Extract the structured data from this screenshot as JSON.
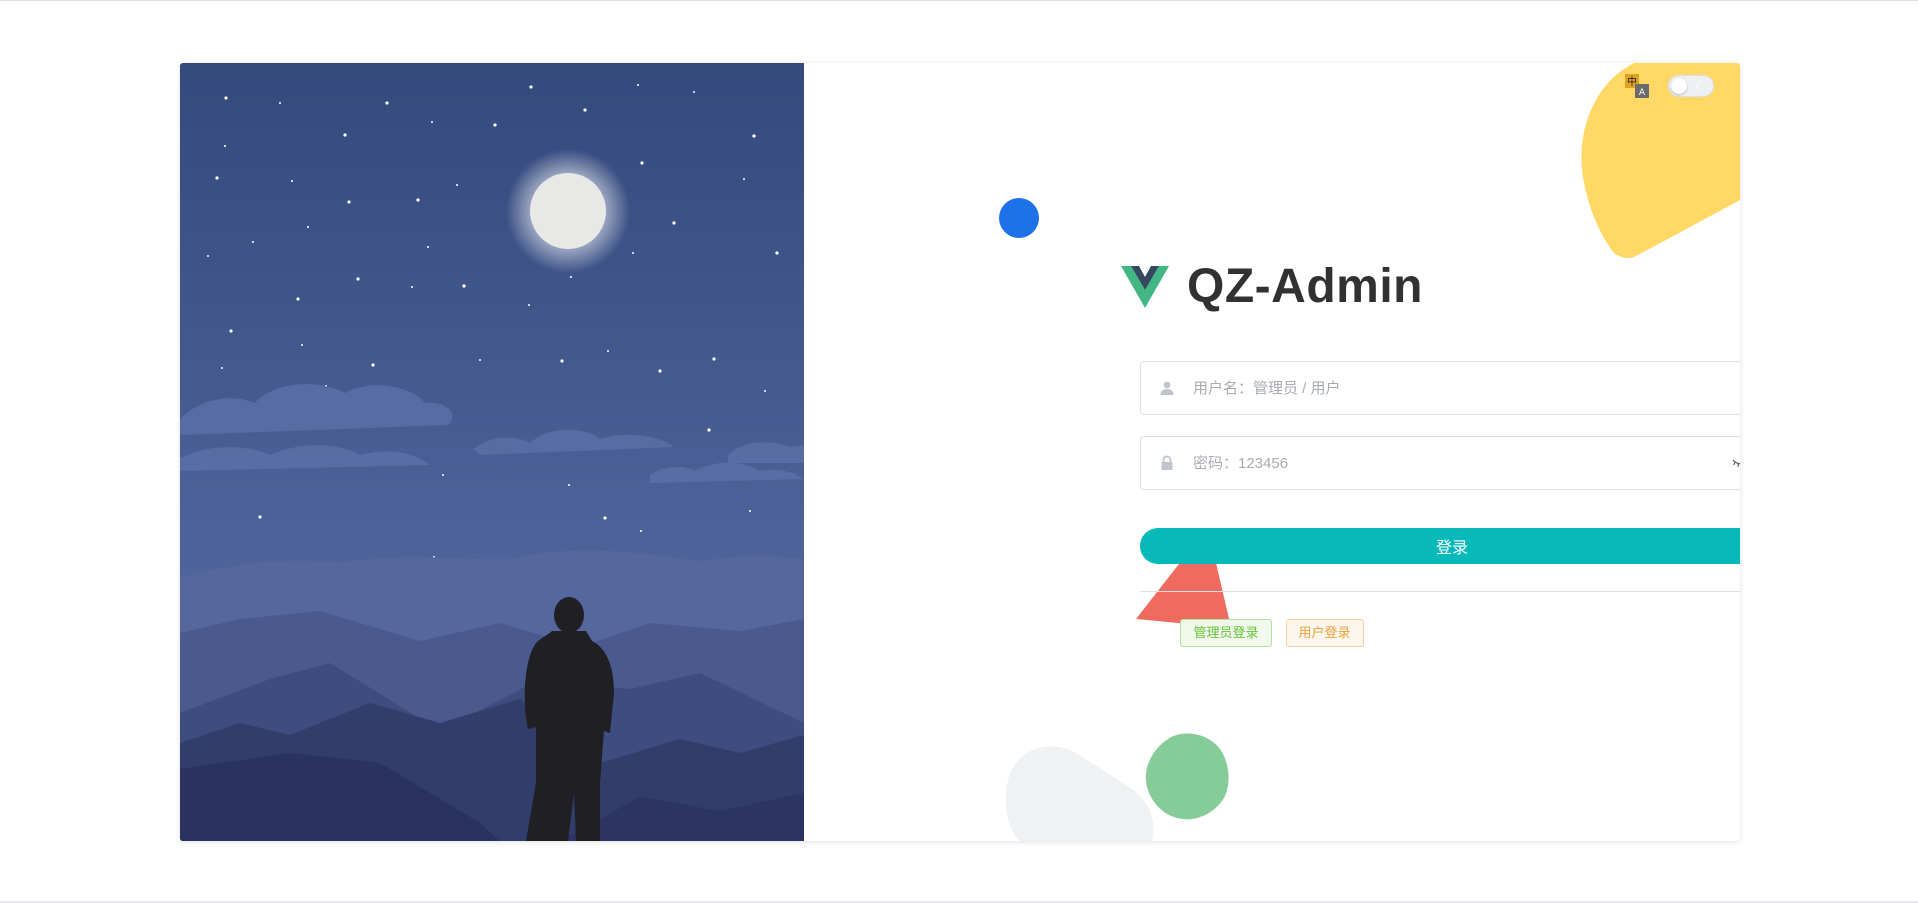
{
  "app": {
    "title": "QZ-Admin"
  },
  "toolbar": {
    "language_icon": "translate-icon",
    "theme_icon": "moon-icon",
    "theme_glyph": "☾",
    "dark_mode": false
  },
  "login_form": {
    "username": {
      "placeholder": "用户名：管理员 / 用户",
      "value": "",
      "icon": "user-icon"
    },
    "password": {
      "placeholder": "密码：123456",
      "value": "",
      "icon": "lock-icon",
      "toggle_icon": "eye-closed-icon"
    },
    "submit_label": "登录"
  },
  "quick_login": {
    "admin_label": "管理员登录",
    "user_label": "用户登录"
  },
  "colors": {
    "accent": "#07b9b9",
    "sky": "#3d5488",
    "admin_tag": "#67c23a",
    "user_tag": "#e6a23c",
    "deco_yellow": "#ffd866",
    "deco_blue": "#1d72ea",
    "deco_red": "#ef6b5f",
    "deco_green": "#85cc98"
  }
}
